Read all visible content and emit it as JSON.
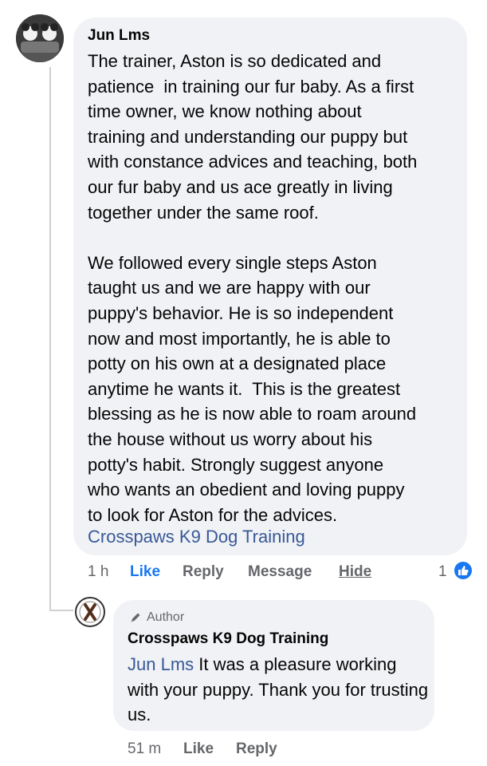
{
  "comment": {
    "author": "Jun Lms",
    "text": "The trainer, Aston is so dedicated and\npatience  in training our fur baby. As a first\ntime owner, we know nothing about\ntraining and understanding our puppy but\nwith constance advices and teaching, both\nour fur baby and us ace greatly in living\ntogether under the same roof.\n\nWe followed every single steps Aston\ntaught us and we are happy with our\npuppy's behavior. He is so independent\nnow and most importantly, he is able to\npotty on his own at a designated place\nanytime he wants it.  This is the greatest\nblessing as he is now able to roam around\nthe house without us worry about his\npotty's habit. Strongly suggest anyone\nwho wants an obedient and loving puppy\nto look for Aston for the advices.",
    "tagged_page": "Crosspaws K9 Dog Training",
    "time": "1 h",
    "like_label": "Like",
    "reply_label": "Reply",
    "message_label": "Message",
    "hide_label": "Hide",
    "reaction_count": "1",
    "like_color": "#1877f2"
  },
  "reply": {
    "badge": "Author",
    "author": "Crosspaws K9 Dog Training",
    "mention": "Jun Lms",
    "text": " It was a pleasure working with your puppy. Thank you for trusting us.",
    "time": "51 m",
    "like_label": "Like",
    "reply_label": "Reply"
  }
}
